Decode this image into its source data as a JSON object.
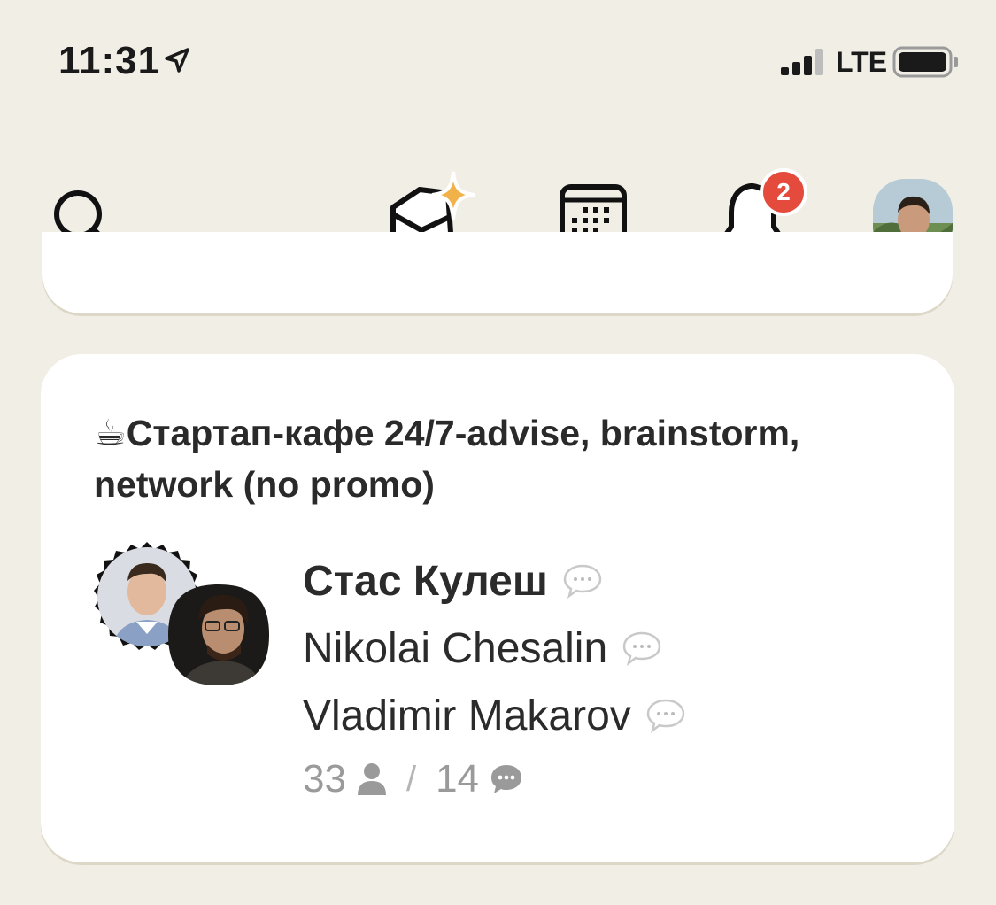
{
  "status_bar": {
    "time": "11:31",
    "carrier": "LTE"
  },
  "nav": {
    "notification_count": "2"
  },
  "room": {
    "cup_emoji": "☕",
    "title": "Стартап-кафе 24/7-advise, brainstorm, network (no promo)",
    "speakers": [
      {
        "name": "Стас Кулеш"
      },
      {
        "name": "Nikolai Chesalin"
      },
      {
        "name": "Vladimir Makarov"
      }
    ],
    "listener_count": "33",
    "speaker_count": "14"
  },
  "colors": {
    "background": "#f1eee6",
    "card": "#ffffff",
    "badge": "#e54b3c",
    "muted": "#9a9a9a",
    "sparkle": "#f2b24a"
  }
}
